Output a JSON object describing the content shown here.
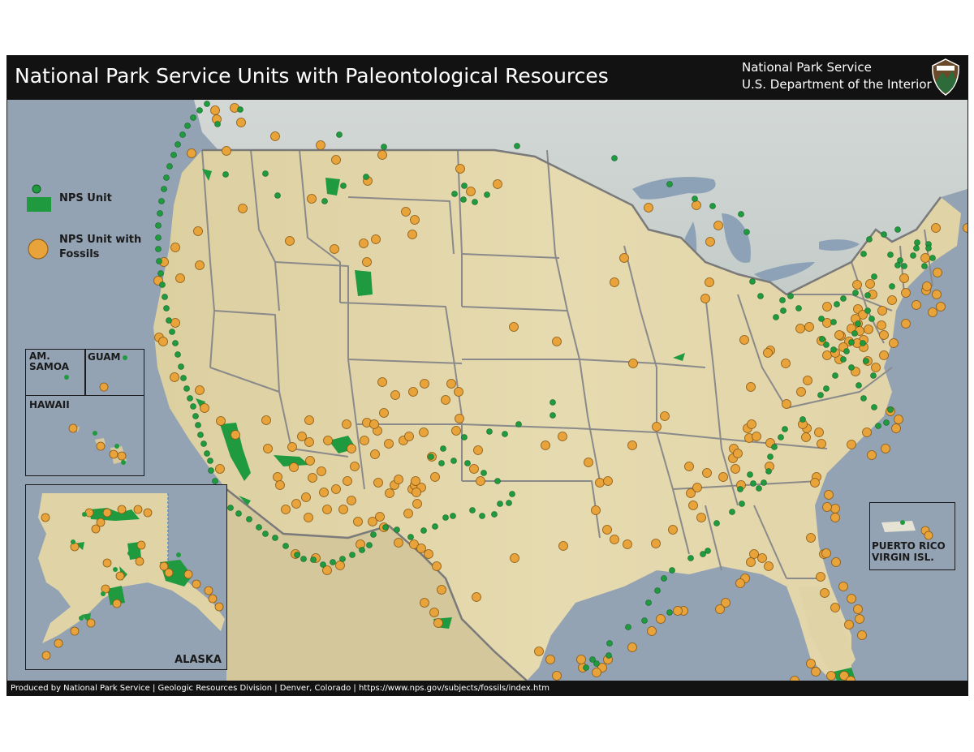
{
  "header": {
    "title": "National Park Service Units with Paleontological Resources",
    "agency_line1": "National Park Service",
    "agency_line2": "U.S. Department of the Interior"
  },
  "legend": {
    "nps_unit": "NPS Unit",
    "fossil_unit_line1": "NPS Unit with",
    "fossil_unit_line2": "Fossils"
  },
  "insets": {
    "samoa_line1": "AM.",
    "samoa_line2": "SAMOA",
    "guam": "GUAM",
    "hawaii": "HAWAII",
    "alaska": "ALASKA",
    "puerto_rico": "PUERTO RICO",
    "virgin_islands": "VIRGIN ISL."
  },
  "footer": {
    "credit": "Produced by National Park Service  |  Geologic Resources Division  |  Denver, Colorado  |  https://www.nps.gov/subjects/fossils/index.htm"
  },
  "colors": {
    "fossil": "#e8a33a",
    "unit": "#1f9a3e",
    "land": "#e3d6a8",
    "ocean": "#93a3b3",
    "canada": "#c9d0cf",
    "mexico": "#d8cba0",
    "state_border": "#8a8a8a"
  }
}
